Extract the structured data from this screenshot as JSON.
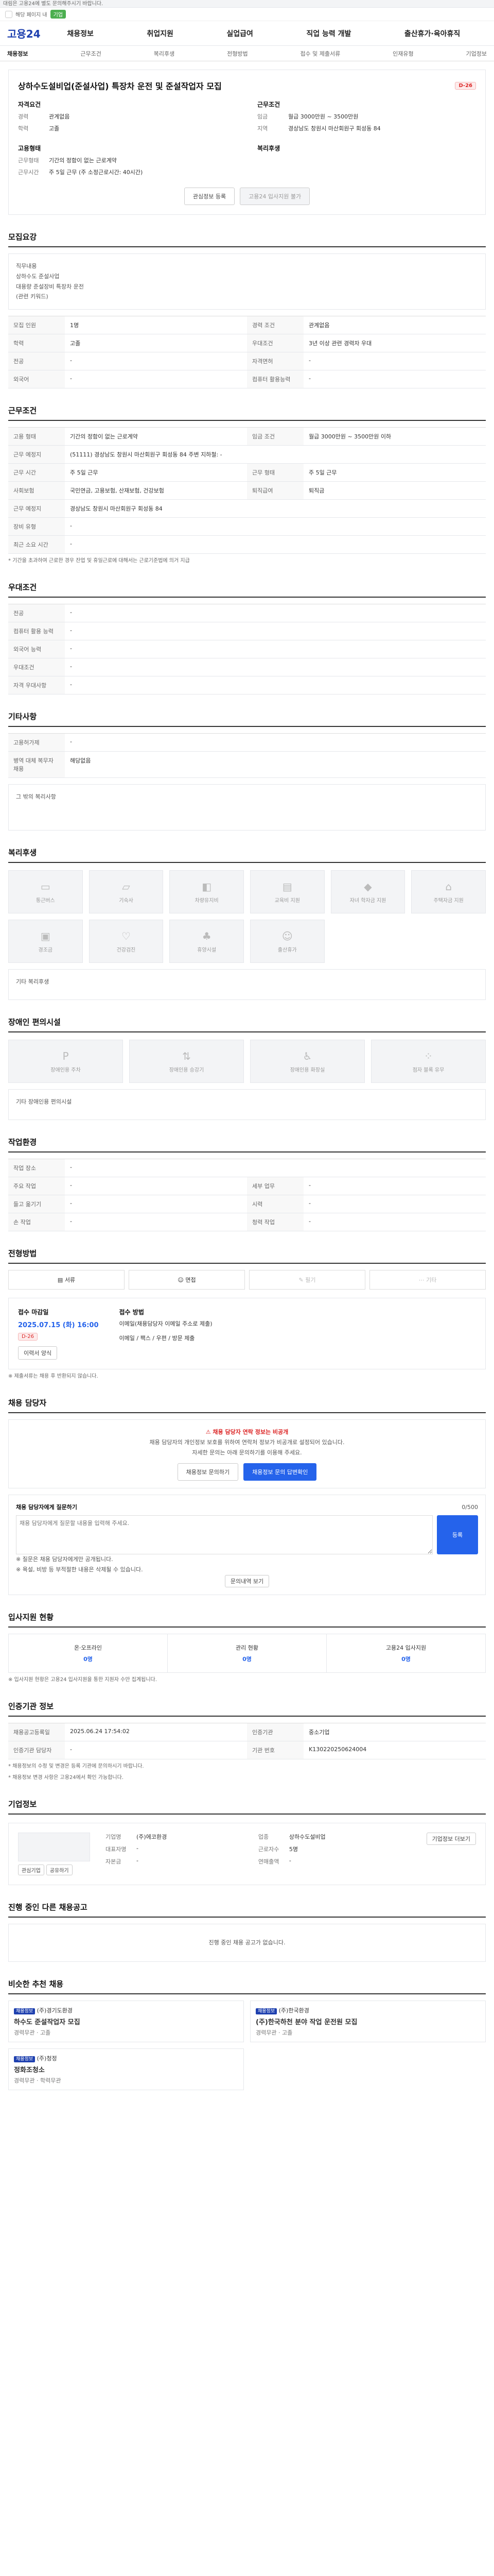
{
  "top": {
    "notice": "대림은 고용24에 별도 문의해주시기 바랍니다.",
    "hint": "해당 페이지 내",
    "badge": "기업"
  },
  "header": {
    "logo": "고용24",
    "nav": [
      "채용정보",
      "취업지원",
      "실업급여",
      "직업 능력 개발",
      "출산휴가·육아휴직"
    ]
  },
  "tabs": [
    "채용정보",
    "근무조건",
    "복리후생",
    "전형방법",
    "접수 및 제출서류",
    "인재유형",
    "기업정보"
  ],
  "job": {
    "title": "상하수도설비업(준설사업) 특장차 운전 및 준설작업자 모집",
    "dday": "D-26",
    "left_h": "자격요건",
    "left": [
      [
        "경력",
        "관계없음"
      ],
      [
        "학력",
        "고졸"
      ]
    ],
    "right_h": "근무조건",
    "right": [
      [
        "임금",
        "월급 3000만원 ~ 3500만원"
      ],
      [
        "지역",
        "경상남도 창원시 마산회원구 회성동 84"
      ]
    ],
    "left2_h": "고용형태",
    "left2": [
      [
        "근무형태",
        "기간의 정함이 없는 근로계약"
      ],
      [
        "근무시간",
        "주 5일 근무 (주 소정근로시간: 40시간)"
      ]
    ],
    "right2_h": "복리후생",
    "right2": [],
    "btn_interest": "관심정보 등록",
    "btn_apply": "고용24 입사지원 불가"
  },
  "duty": {
    "h": "모집요강",
    "text": [
      "직무내용",
      "상하수도 준설사업",
      "대용량 준설장비 특장차 운전",
      "",
      "(관련 키워드)"
    ]
  },
  "req": {
    "rows": [
      [
        "모집 인원",
        "1명",
        "경력 조건",
        "관계없음"
      ],
      [
        "학력",
        "고졸",
        "",
        "3년 이상 관련 경력자 우대"
      ],
      [
        "전공",
        "-",
        "자격면허",
        "-"
      ],
      [
        "외국어",
        "-",
        "컴퓨터 활용능력",
        "-"
      ]
    ],
    "prefer": "우대조건"
  },
  "cond": {
    "h": "근무조건",
    "rows": [
      [
        "고용 형태",
        "기간의 정함이 없는 근로계약",
        "임금 조건",
        "월급 3000만원 ~ 3500만원 이하"
      ],
      [
        "근무 예정지",
        "(51111) 경상남도 창원시 마산회원구 회성동 84 주변 지하철: -",
        "",
        ""
      ],
      [
        "근무 시간",
        "주 5일 근무",
        "근무 형태",
        "주 5일 근무"
      ],
      [
        "사회보험",
        "국민연금, 고용보험, 산재보험, 건강보험",
        "퇴직급여",
        "퇴직금"
      ],
      [
        "근무 예정지",
        "경상남도 창원시 마산회원구 회성동 84",
        "",
        ""
      ],
      [
        "장비 유형",
        "-",
        "",
        ""
      ],
      [
        "최근 소요 시간",
        "-",
        "",
        ""
      ]
    ],
    "note": "* 기간을 초과하여 근로한 경우 잔업 및 휴일근로에 대해서는 근로기준법에 의거 지급"
  },
  "basic": {
    "h": "우대조건",
    "rows": [
      [
        "전공",
        "-"
      ],
      [
        "컴퓨터 활용 능력",
        "-"
      ],
      [
        "외국어 능력",
        "-"
      ],
      [
        "우대조건",
        "-"
      ],
      [
        "자격 우대사항",
        "-"
      ]
    ]
  },
  "other": {
    "h": "기타사항",
    "rows": [
      [
        "고용허가제",
        "-"
      ],
      [
        "병역 대체 복무자 채용",
        "해당없음"
      ]
    ],
    "etc": "그 밖의 복리사항"
  },
  "welfare": {
    "h": "복리후생",
    "items": [
      "통근버스",
      "기숙사",
      "차량유지비",
      "교육비 지원",
      "자녀 학자금 지원",
      "주택자금 지원",
      "경조금",
      "건강검진",
      "휴양시설",
      "출산휴가"
    ],
    "note": "기타 복리후생"
  },
  "disabled": {
    "h": "장애인 편의시설",
    "items": [
      "장애인용 주차",
      "장애인용 승강기",
      "장애인용 화장실",
      "점자 블록 유무"
    ],
    "note": "기타 장애인용 편의시설"
  },
  "env": {
    "h": "작업환경",
    "rows": [
      [
        "작업 장소",
        "-",
        "",
        ""
      ],
      [
        "주요 작업",
        "-",
        "세부 업무",
        "-"
      ],
      [
        "들고 옮기기",
        "-",
        "시력",
        "-"
      ],
      [
        "손 작업",
        "-",
        "청력 작업",
        "-"
      ]
    ]
  },
  "method": {
    "h": "전형방법",
    "steps": [
      "서류",
      "면접",
      "필기",
      "기타"
    ],
    "period_l": "접수 마감일",
    "period": "2025.07.15 (화) 16:00",
    "dday": "D-26",
    "apply_l": "접수 방법",
    "apply": "이메일(채용담당자 이메일 주소로 제출)",
    "apply2": "이메일 / 팩스 / 우편 / 방문 제출",
    "docs_btn": "이력서 양식",
    "note": "※ 제출서류는 채용 후 반환되지 않습니다."
  },
  "contact": {
    "h": "채용 담당자",
    "title": "채용 담당자 연락 정보는 비공개",
    "text": "채용 담당자의 개인정보 보호를 위하여 연락처 정보가 비공개로 설정되어 있습니다.",
    "note": "자세한 문의는 아래 문의하기를 이용해 주세요.",
    "btn1": "채용정보 문의하기",
    "btn2": "채용정보 문의 답변확인"
  },
  "inquiry": {
    "h": "채용 담당자에게 질문하기",
    "limit": "0/500",
    "placeholder": "채용 담당자에게 질문할 내용을 입력해 주세요.",
    "btn": "등록",
    "notes": [
      "※ 질문은 채용 담당자에게만 공개됩니다.",
      "※ 욕설, 비방 등 부적절한 내용은 삭제될 수 있습니다."
    ],
    "btn_more": "문의내역 보기"
  },
  "apps": {
    "h": "입사지원 현황",
    "cols": [
      [
        "온·오프라인",
        "0명"
      ],
      [
        "관리 현황",
        "0명"
      ],
      [
        "고용24 입사지원",
        "0명"
      ]
    ],
    "note": "※ 입사지원 현황은 고용24 입사지원을 통한 지원자 수만 집계됩니다."
  },
  "reg": {
    "h": "인증기관 정보",
    "rows": [
      [
        "채용공고등록일",
        "2025.06.24 17:54:02",
        "인증기관",
        "중소기업"
      ],
      [
        "인증기관 담당자",
        "-",
        "기관 번호",
        "K130220250624004"
      ]
    ],
    "note1": "* 채용정보의 수정 및 변경은 등록 기관에 문의하시기 바랍니다.",
    "note2": "* 채용정보 변경 사항은 고용24에서 확인 가능합니다."
  },
  "company": {
    "h": "기업정보",
    "rows": [
      [
        "기업명",
        "(주)에코환경",
        "업종",
        "상하수도설비업"
      ],
      [
        "대표자명",
        "-",
        "근로자수",
        "5명"
      ],
      [
        "자본금",
        "-",
        "연매출액",
        "-"
      ]
    ],
    "btn": "기업정보 더보기",
    "logo_btns": [
      "관심기업",
      "공유하기"
    ]
  },
  "others": {
    "h": "진행 중인 다른 채용공고",
    "empty": "진행 중인 채용 공고가 없습니다."
  },
  "recs": {
    "h": "비슷한 추천 채용",
    "items": [
      {
        "tag": "채용정보",
        "co": "(주)경기도환경",
        "title": "하수도 준설작업자 모집",
        "info": "경력무관 · 고졸"
      },
      {
        "tag": "채용정보",
        "co": "(주)한국환경",
        "title": "(주)한국하천 분야 작업 운전원 모집",
        "info": "경력무관 · 고졸"
      },
      {
        "tag": "채용정보",
        "co": "(주)청정",
        "title": "정화조청소",
        "info": "경력무관 · 학력무관"
      }
    ]
  }
}
